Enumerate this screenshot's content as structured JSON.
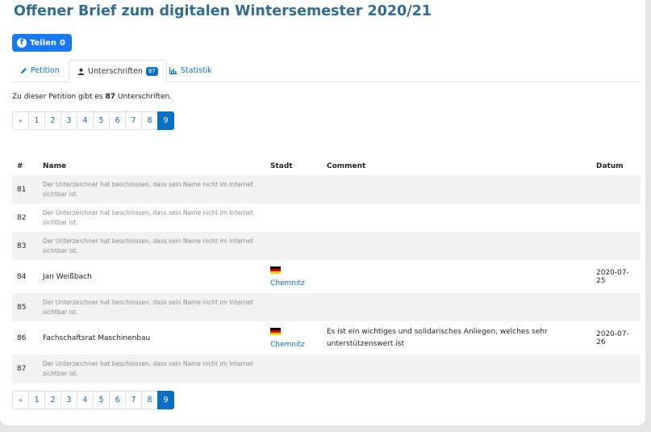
{
  "title": "Offener Brief zum digitalen Wintersemester 2020/21",
  "share_button": {
    "label": "Teilen",
    "count": "0"
  },
  "tabs": [
    {
      "label": "Petition",
      "icon": "pencil-icon"
    },
    {
      "label": "Unterschriften",
      "icon": "user-icon",
      "badge": "87"
    },
    {
      "label": "Statistik",
      "icon": "bar-chart-icon"
    }
  ],
  "info": {
    "prefix": "Zu dieser Petition gibt es",
    "count": "87",
    "suffix": "Unterschriften."
  },
  "pagination": {
    "prev": "«",
    "pages": [
      "1",
      "2",
      "3",
      "4",
      "5",
      "6",
      "7",
      "8",
      "9"
    ],
    "active": "9"
  },
  "table": {
    "headers": {
      "num": "#",
      "name": "Name",
      "city": "Stadt",
      "comment": "Comment",
      "date": "Datum"
    },
    "hidden_text": "Der Unterzeichner hat beschlossen, dass sein Name nicht im Internet sichtbar ist.",
    "rows": [
      {
        "num": "81",
        "name": "",
        "city": "",
        "comment": "",
        "date": ""
      },
      {
        "num": "82",
        "name": "",
        "city": "",
        "comment": "",
        "date": ""
      },
      {
        "num": "83",
        "name": "",
        "city": "",
        "comment": "",
        "date": ""
      },
      {
        "num": "84",
        "name": "Jan Weißbach",
        "city": "Chemnitz",
        "comment": "",
        "date": "2020-07-25"
      },
      {
        "num": "85",
        "name": "",
        "city": "",
        "comment": "",
        "date": ""
      },
      {
        "num": "86",
        "name": "Fachschaftsrat Maschinenbau",
        "city": "Chemnitz",
        "comment": "Es ist ein wichtiges und solidarisches Anliegen, welches sehr unterstützenswert ist",
        "date": "2020-07-26"
      },
      {
        "num": "87",
        "name": "",
        "city": "",
        "comment": "",
        "date": ""
      }
    ]
  },
  "colors": {
    "title": "#2f6c96",
    "link": "#0b6fc2",
    "facebook": "#1877f2"
  }
}
